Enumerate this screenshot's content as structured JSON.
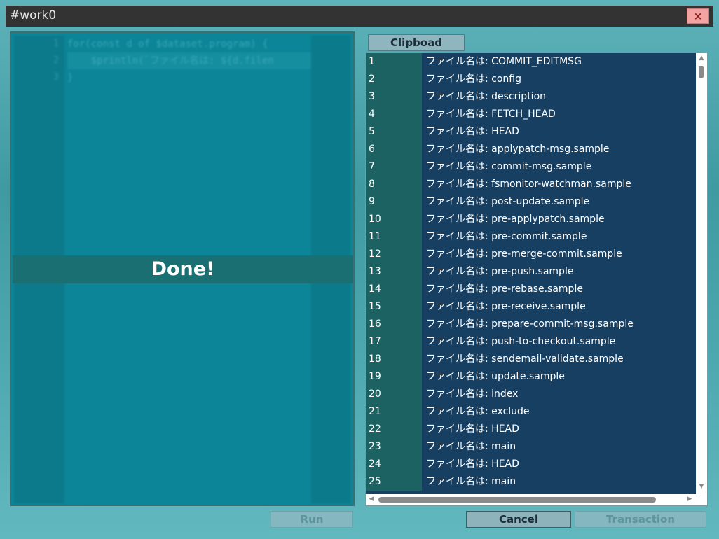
{
  "window": {
    "title": "#work0",
    "close_label": "×"
  },
  "editor": {
    "line_numbers": [
      "1",
      "2",
      "3"
    ],
    "code_lines": [
      "for(const d of $dataset.program) {",
      "    $println(`ファイル名は: ${d.filen",
      "}"
    ],
    "status": "Done!"
  },
  "output": {
    "tab_label": "Clipboad",
    "rows": [
      {
        "num": "1",
        "text": "ファイル名は: COMMIT_EDITMSG"
      },
      {
        "num": "2",
        "text": "ファイル名は: config"
      },
      {
        "num": "3",
        "text": "ファイル名は: description"
      },
      {
        "num": "4",
        "text": "ファイル名は: FETCH_HEAD"
      },
      {
        "num": "5",
        "text": "ファイル名は: HEAD"
      },
      {
        "num": "6",
        "text": "ファイル名は: applypatch-msg.sample"
      },
      {
        "num": "7",
        "text": "ファイル名は: commit-msg.sample"
      },
      {
        "num": "8",
        "text": "ファイル名は: fsmonitor-watchman.sample"
      },
      {
        "num": "9",
        "text": "ファイル名は: post-update.sample"
      },
      {
        "num": "10",
        "text": "ファイル名は: pre-applypatch.sample"
      },
      {
        "num": "11",
        "text": "ファイル名は: pre-commit.sample"
      },
      {
        "num": "12",
        "text": "ファイル名は: pre-merge-commit.sample"
      },
      {
        "num": "13",
        "text": "ファイル名は: pre-push.sample"
      },
      {
        "num": "14",
        "text": "ファイル名は: pre-rebase.sample"
      },
      {
        "num": "15",
        "text": "ファイル名は: pre-receive.sample"
      },
      {
        "num": "16",
        "text": "ファイル名は: prepare-commit-msg.sample"
      },
      {
        "num": "17",
        "text": "ファイル名は: push-to-checkout.sample"
      },
      {
        "num": "18",
        "text": "ファイル名は: sendemail-validate.sample"
      },
      {
        "num": "19",
        "text": "ファイル名は: update.sample"
      },
      {
        "num": "20",
        "text": "ファイル名は: index"
      },
      {
        "num": "21",
        "text": "ファイル名は: exclude"
      },
      {
        "num": "22",
        "text": "ファイル名は: HEAD"
      },
      {
        "num": "23",
        "text": "ファイル名は: main"
      },
      {
        "num": "24",
        "text": "ファイル名は: HEAD"
      },
      {
        "num": "25",
        "text": "ファイル名は: main"
      }
    ]
  },
  "buttons": {
    "run": "Run",
    "cancel": "Cancel",
    "transaction": "Transaction"
  },
  "colors": {
    "row_number_bg": "#1c6262",
    "row_text_bg": "#163f62",
    "close_button_bg": "#f4a3a3",
    "editor_bg": "#0c8598"
  }
}
